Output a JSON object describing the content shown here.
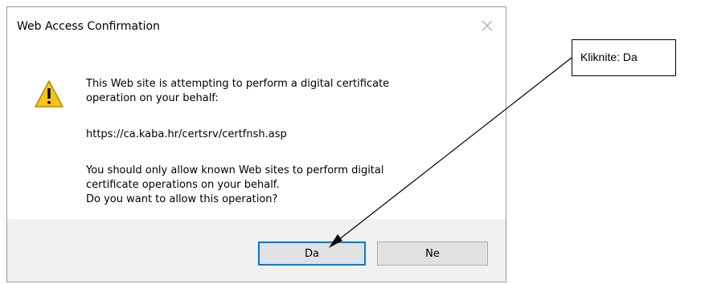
{
  "dialog": {
    "title": "Web Access Confirmation",
    "message_lines": [
      "This Web site is attempting to perform a digital certificate",
      "operation on your behalf:"
    ],
    "url": "https://ca.kaba.hr/certsrv/certfnsh.asp",
    "advice_lines": [
      "You should only allow known Web sites to perform digital",
      "certificate operations on your behalf.",
      "Do you want to allow this operation?"
    ],
    "yes_label": "Da",
    "no_label": "Ne",
    "icon": "warning-icon"
  },
  "callout": {
    "text": "Kliknite: Da"
  },
  "colors": {
    "footer_bg": "#f0f0f0",
    "focus_border": "#0078d7",
    "warning_fill": "#f5c518"
  }
}
